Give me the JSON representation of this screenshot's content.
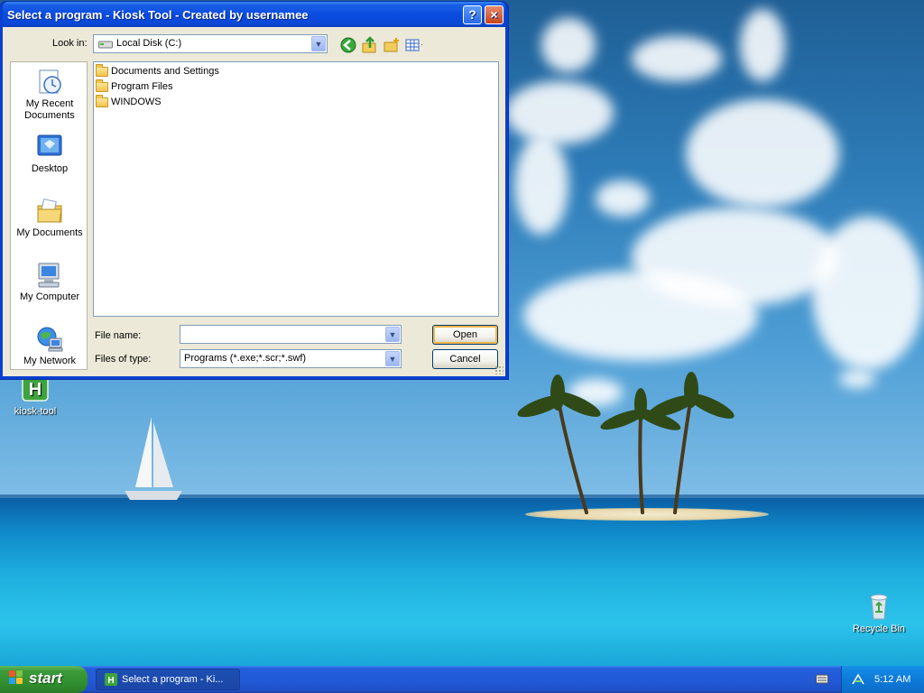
{
  "window": {
    "title": "Select a program - Kiosk Tool - Created by usernamee",
    "help_button": "?",
    "close_button": "×"
  },
  "lookin": {
    "label": "Look in:",
    "value": "Local Disk (C:)"
  },
  "places": [
    {
      "label": "My Recent Documents",
      "icon": "recent-documents-icon"
    },
    {
      "label": "Desktop",
      "icon": "desktop-icon"
    },
    {
      "label": "My Documents",
      "icon": "my-documents-icon"
    },
    {
      "label": "My Computer",
      "icon": "my-computer-icon"
    },
    {
      "label": "My Network",
      "icon": "my-network-icon"
    }
  ],
  "files": [
    {
      "name": "Documents and Settings"
    },
    {
      "name": "Program Files"
    },
    {
      "name": "WINDOWS"
    }
  ],
  "filename": {
    "label": "File name:",
    "value": ""
  },
  "filetype": {
    "label": "Files of type:",
    "value": "Programs (*.exe;*.scr;*.swf)"
  },
  "buttons": {
    "open": "Open",
    "cancel": "Cancel"
  },
  "desktop": {
    "icons": [
      {
        "label": "kiosk-tool"
      },
      {
        "label": "Recycle Bin"
      }
    ]
  },
  "taskbar": {
    "start": "start",
    "task": "Select a program - Ki...",
    "clock": "5:12 AM"
  }
}
